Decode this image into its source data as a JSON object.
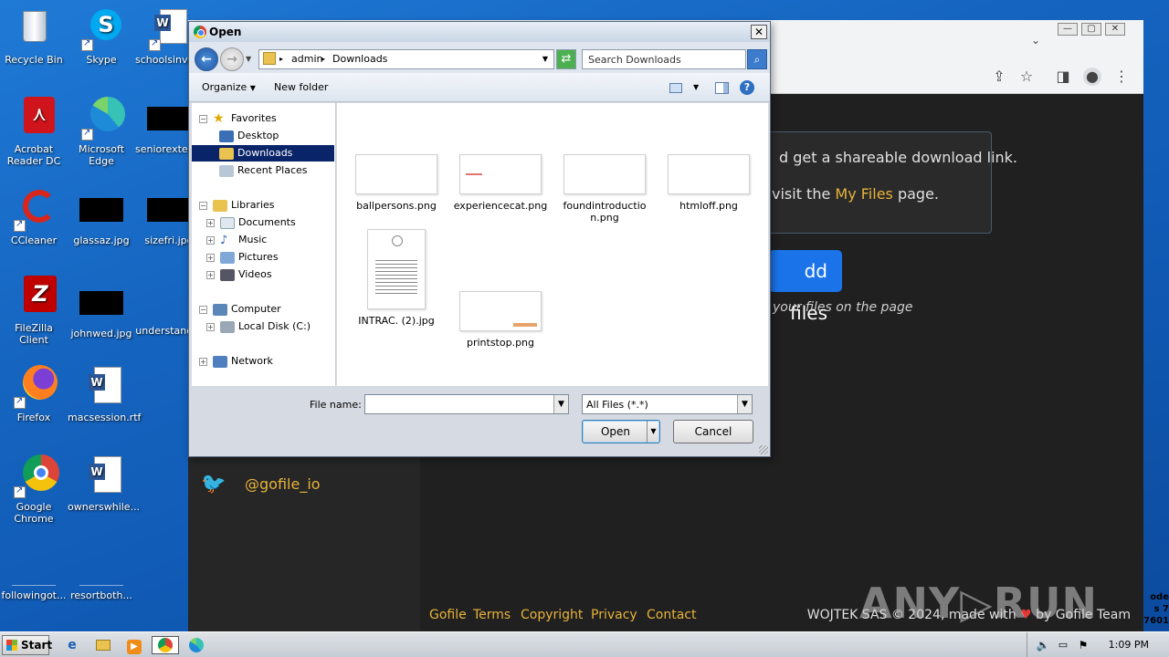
{
  "desktop": {
    "icons": [
      {
        "label": "Recycle Bin"
      },
      {
        "label": "Skype"
      },
      {
        "label": "schoolsinvo..."
      },
      {
        "label": "Acrobat Reader DC"
      },
      {
        "label": "Microsoft Edge"
      },
      {
        "label": "seniorexten..."
      },
      {
        "label": "CCleaner"
      },
      {
        "label": "glassaz.jpg"
      },
      {
        "label": "sizefri.jpg"
      },
      {
        "label": "FileZilla Client"
      },
      {
        "label": "johnwed.jpg"
      },
      {
        "label": "understand..."
      },
      {
        "label": "Firefox"
      },
      {
        "label": "macsession.rtf"
      },
      {
        "label": "Google Chrome"
      },
      {
        "label": "ownerswhile..."
      },
      {
        "label": "followingot..."
      },
      {
        "label": "resortboth..."
      }
    ]
  },
  "browser": {
    "info_line1": "d get a shareable download link.",
    "info_line2_prefix": "visit the ",
    "info_line2_link": "My Files",
    "info_line2_suffix": " page.",
    "add_files": "dd files",
    "hint": "your files on the page",
    "twitter_handle": "@gofile_io",
    "footer_links": [
      "Gofile",
      "Terms",
      "Copyright",
      "Privacy",
      "Contact"
    ],
    "footer_right_prefix": "WOJTEK SAS © 2024, made with ",
    "footer_right_suffix": " by Gofile Team",
    "watermark": "ANY▷RUN",
    "side_text": "ode\ns 7\n7601"
  },
  "dialog": {
    "title": "Open",
    "breadcrumb": [
      "admin",
      "Downloads"
    ],
    "search_placeholder": "Search Downloads",
    "organize": "Organize",
    "new_folder": "New folder",
    "tree": {
      "favorites": "Favorites",
      "desktop": "Desktop",
      "downloads": "Downloads",
      "recent": "Recent Places",
      "libraries": "Libraries",
      "documents": "Documents",
      "music": "Music",
      "pictures": "Pictures",
      "videos": "Videos",
      "computer": "Computer",
      "local_disk": "Local Disk (C:)",
      "network": "Network"
    },
    "files": [
      {
        "name": "ballpersons.png"
      },
      {
        "name": "experiencecat.png"
      },
      {
        "name": "foundintroduction.png"
      },
      {
        "name": "htmloff.png"
      },
      {
        "name": "INTRAC. (2).jpg"
      },
      {
        "name": "printstop.png"
      }
    ],
    "file_name_label": "File name:",
    "file_name_value": "",
    "filter": "All Files (*.*)",
    "open": "Open",
    "cancel": "Cancel"
  },
  "taskbar": {
    "start": "Start",
    "clock": "1:09 PM"
  }
}
